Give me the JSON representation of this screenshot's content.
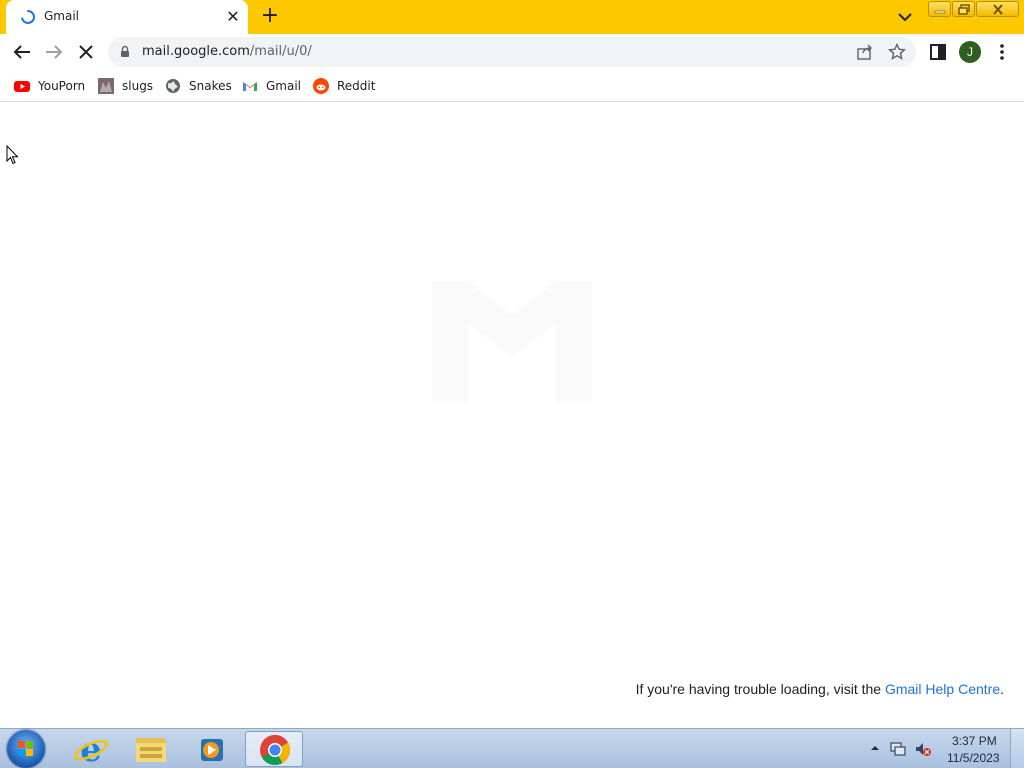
{
  "browser": {
    "tab": {
      "title": "Gmail"
    },
    "address_bar": {
      "host": "mail.google.com",
      "path": "/mail/u/0/"
    },
    "profile_initial": "J",
    "theme_color": "#fdc800"
  },
  "bookmarks": [
    {
      "label": "YouPorn",
      "icon": "youtube-style-red-icon"
    },
    {
      "label": "slugs",
      "icon": "thumbnail-icon"
    },
    {
      "label": "Snakes",
      "icon": "globe-icon"
    },
    {
      "label": "Gmail",
      "icon": "gmail-icon"
    },
    {
      "label": "Reddit",
      "icon": "reddit-icon"
    }
  ],
  "page": {
    "trouble_prefix": "If you're having trouble loading, visit the ",
    "help_link": "Gmail Help Centre",
    "trouble_suffix": "."
  },
  "taskbar": {
    "apps": [
      "internet-explorer",
      "file-explorer",
      "media-player",
      "chrome"
    ],
    "clock_time": "3:37 PM",
    "clock_date": "11/5/2023"
  }
}
